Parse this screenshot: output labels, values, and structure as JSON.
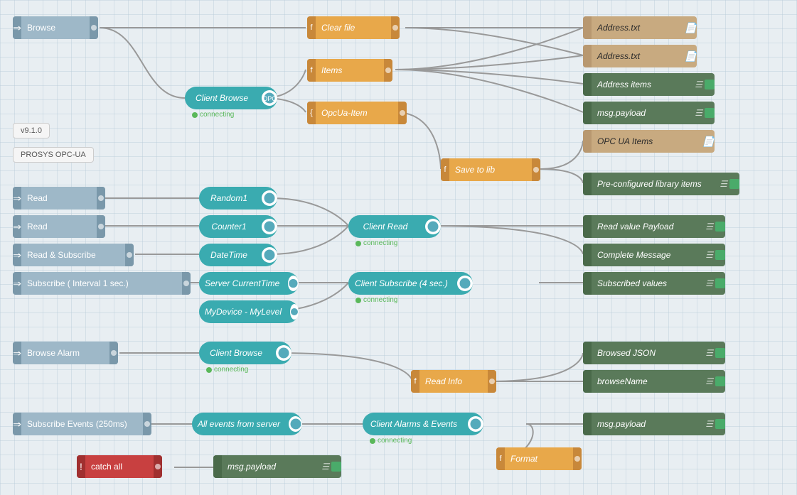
{
  "version": "v9.1.0",
  "brand": "PROSYS OPC-UA",
  "nodes": {
    "browse_input": {
      "label": "Browse",
      "type": "input"
    },
    "clear_file": {
      "label": "Clear file",
      "type": "func"
    },
    "address_txt_1": {
      "label": "Address.txt",
      "type": "file-out"
    },
    "address_txt_2": {
      "label": "Address.txt",
      "type": "file-out"
    },
    "address_items": {
      "label": "Address items",
      "type": "green-out"
    },
    "msg_payload_1": {
      "label": "msg.payload",
      "type": "green-out"
    },
    "opc_ua_items": {
      "label": "OPC UA Items",
      "type": "file-out"
    },
    "preconfigured": {
      "label": "Pre-configured library items",
      "type": "green-out"
    },
    "items_func": {
      "label": "Items",
      "type": "func"
    },
    "opcua_item": {
      "label": "OpcUa-Item",
      "type": "func"
    },
    "save_to_lib": {
      "label": "Save to lib",
      "type": "func"
    },
    "client_browse": {
      "label": "Client Browse",
      "type": "teal"
    },
    "connecting_1": {
      "label": "connecting"
    },
    "read_1": {
      "label": "Read",
      "type": "input"
    },
    "read_2": {
      "label": "Read",
      "type": "input"
    },
    "read_subscribe": {
      "label": "Read & Subscribe",
      "type": "input"
    },
    "subscribe_interval": {
      "label": "Subscribe ( Interval 1 sec.)",
      "type": "input"
    },
    "random1": {
      "label": "Random1",
      "type": "teal"
    },
    "counter1": {
      "label": "Counter1",
      "type": "teal"
    },
    "datetime": {
      "label": "DateTime",
      "type": "teal"
    },
    "server_current": {
      "label": "Server CurrentTime",
      "type": "teal"
    },
    "mydevice": {
      "label": "MyDevice - MyLevel",
      "type": "teal"
    },
    "client_read": {
      "label": "Client Read",
      "type": "teal"
    },
    "connecting_2": {
      "label": "connecting"
    },
    "client_subscribe": {
      "label": "Client Subscribe (4 sec.)",
      "type": "teal"
    },
    "connecting_3": {
      "label": "connecting"
    },
    "read_value": {
      "label": "Read value Payload",
      "type": "green-out"
    },
    "complete_msg": {
      "label": "Complete Message",
      "type": "green-out"
    },
    "subscribed_values": {
      "label": "Subscribed values",
      "type": "green-out"
    },
    "browse_alarm_input": {
      "label": "Browse Alarm",
      "type": "input"
    },
    "client_browse_2": {
      "label": "Client Browse",
      "type": "teal"
    },
    "connecting_4": {
      "label": "connecting"
    },
    "read_info": {
      "label": "Read Info",
      "type": "func"
    },
    "browsed_json": {
      "label": "Browsed JSON",
      "type": "green-out"
    },
    "browse_name": {
      "label": "browseName",
      "type": "green-out"
    },
    "subscribe_events_input": {
      "label": "Subscribe Events (250ms)",
      "type": "input"
    },
    "all_events": {
      "label": "All events from server",
      "type": "teal"
    },
    "client_alarms": {
      "label": "Client Alarms & Events",
      "type": "teal"
    },
    "connecting_5": {
      "label": "connecting"
    },
    "msg_payload_2": {
      "label": "msg.payload",
      "type": "green-out"
    },
    "catch_all": {
      "label": "catch all",
      "type": "error"
    },
    "msg_payload_3": {
      "label": "msg.payload",
      "type": "green-out"
    },
    "format_func": {
      "label": "Format",
      "type": "func"
    }
  }
}
